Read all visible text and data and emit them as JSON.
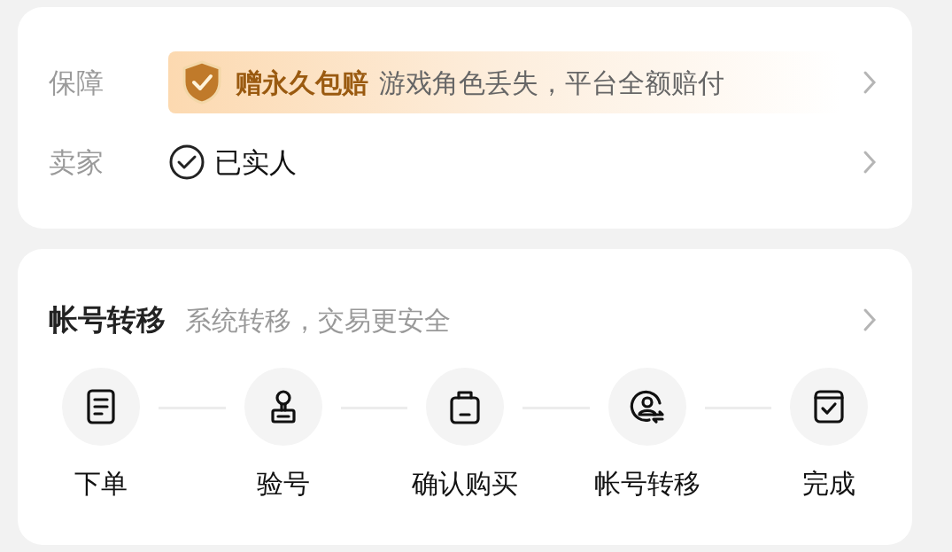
{
  "guarantee": {
    "label": "保障",
    "badge_title": "赠永久包赔",
    "badge_text": "游戏角色丢失，平台全额赔付"
  },
  "seller": {
    "label": "卖家",
    "status": "已实人"
  },
  "transfer": {
    "title": "帐号转移",
    "subtitle": "系统转移，交易更安全",
    "steps": [
      {
        "kind": "order",
        "label": "下单"
      },
      {
        "kind": "verify",
        "label": "验号"
      },
      {
        "kind": "confirm",
        "label": "确认购买"
      },
      {
        "kind": "transfer",
        "label": "帐号转移"
      },
      {
        "kind": "done",
        "label": "完成"
      }
    ]
  }
}
